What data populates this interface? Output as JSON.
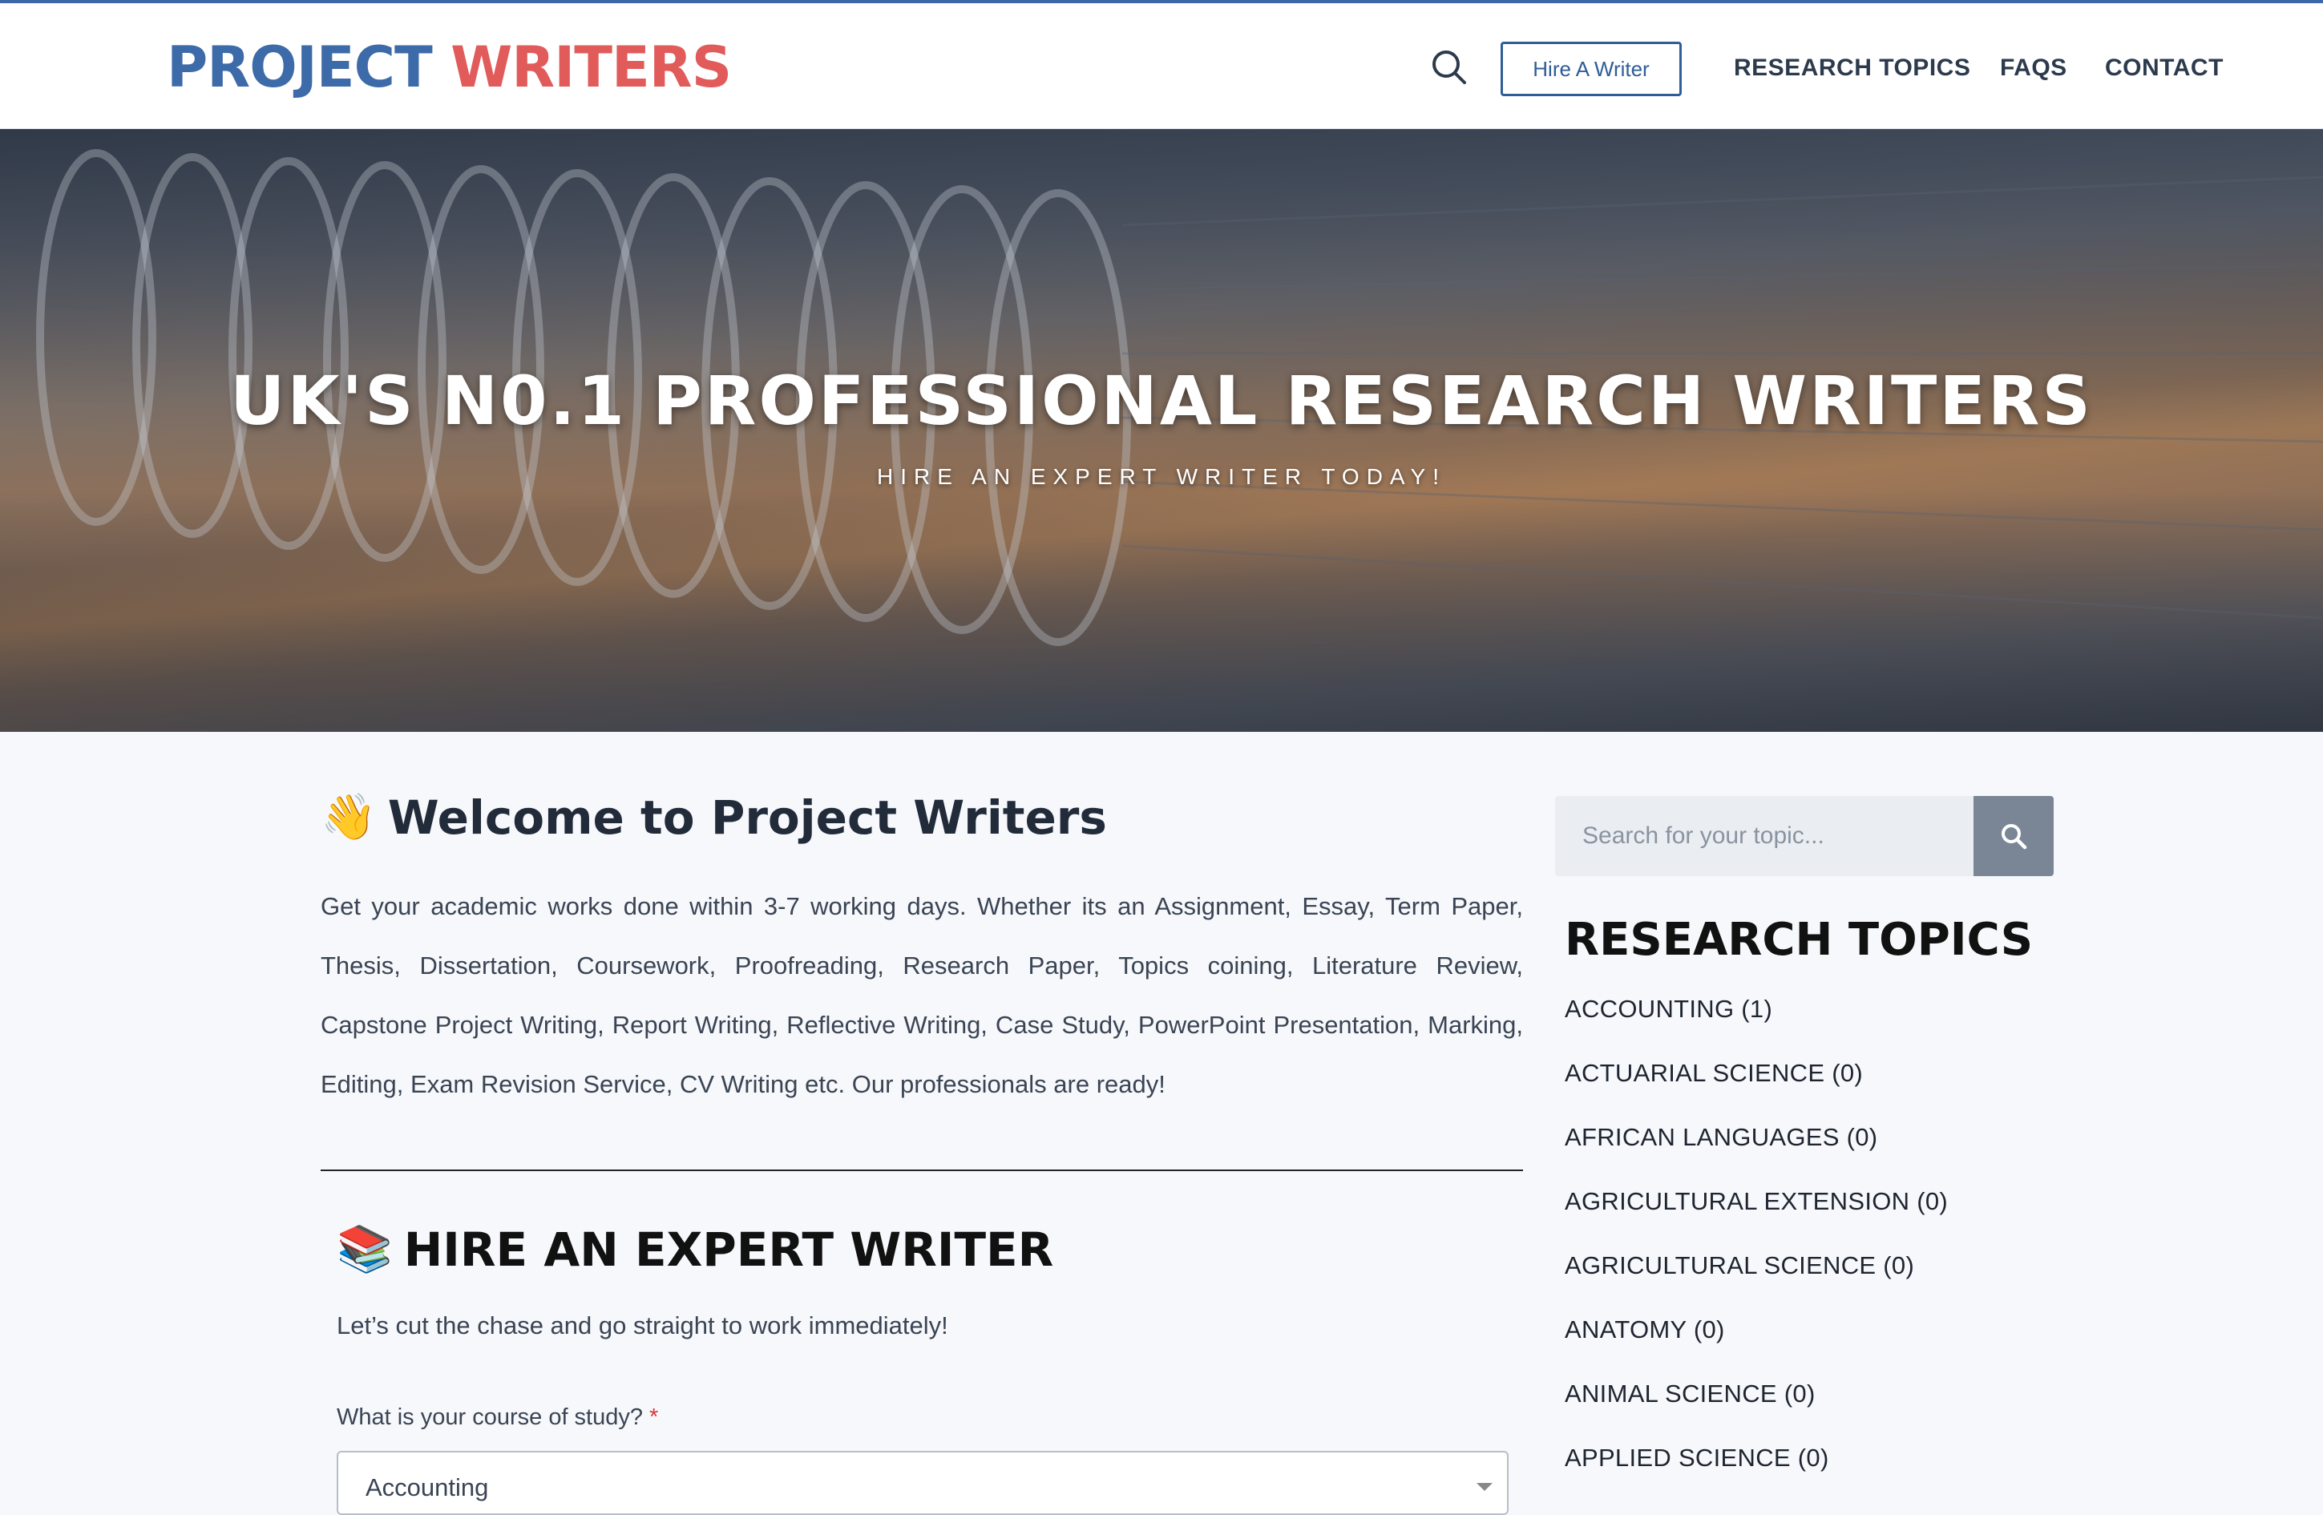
{
  "header": {
    "logo_part1": "PROJECT",
    "logo_part2": "WRITERS",
    "hire_button": "Hire A Writer",
    "nav": [
      "RESEARCH TOPICS",
      "FAQS",
      "CONTACT"
    ]
  },
  "hero": {
    "title": "UK'S N0.1 PROFESSIONAL RESEARCH WRITERS",
    "subtitle": "HIRE AN EXPERT WRITER TODAY!"
  },
  "welcome": {
    "emoji": "👋",
    "heading": "Welcome to Project Writers",
    "body": "Get your academic works done within 3-7 working days. Whether its an Assignment, Essay, Term Paper, Thesis, Dissertation, Coursework, Proofreading, Research Paper, Topics coining, Literature Review, Capstone Project Writing, Report Writing, Reflective Writing, Case Study, PowerPoint Presentation, Marking, Editing, Exam Revision Service, CV Writing etc. Our professionals are ready!"
  },
  "hire": {
    "emoji": "📚",
    "heading": "HIRE AN EXPERT WRITER",
    "text": "Let’s cut the chase and go straight to work immediately!",
    "field_label": "What is your course of study?",
    "required_mark": "*",
    "selected_course": "Accounting"
  },
  "sidebar": {
    "search_placeholder": "Search for your topic...",
    "title": "RESEARCH TOPICS",
    "topics": [
      "ACCOUNTING (1)",
      "ACTUARIAL SCIENCE (0)",
      "AFRICAN LANGUAGES (0)",
      "AGRICULTURAL EXTENSION (0)",
      "AGRICULTURAL SCIENCE (0)",
      "ANATOMY (0)",
      "ANIMAL SCIENCE (0)",
      "APPLIED SCIENCE (0)"
    ]
  },
  "colors": {
    "brand_blue": "#3d6aa8",
    "brand_red": "#e15b5b",
    "search_button": "#7a8696"
  },
  "icons": {
    "header_search": "search-icon",
    "sidebar_search": "search-icon"
  }
}
